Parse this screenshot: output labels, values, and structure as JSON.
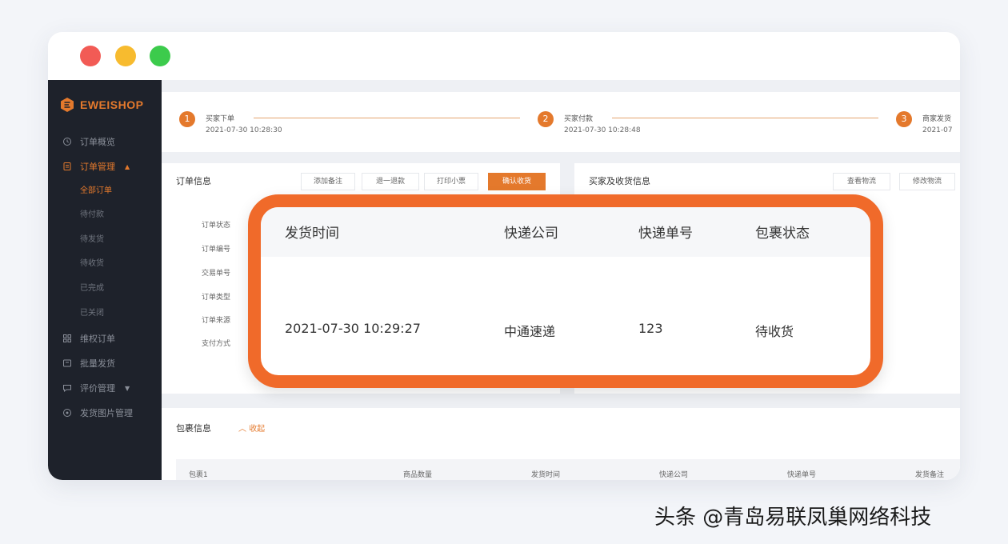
{
  "window": {
    "controls": [
      {
        "name": "close",
        "color": "#f25b55"
      },
      {
        "name": "minimize",
        "color": "#f7bb2f"
      },
      {
        "name": "maximize",
        "color": "#3ccb4c"
      }
    ]
  },
  "brand": {
    "name": "EWEISHOP",
    "accent": "#e4792c",
    "callout_color": "#f06a2a"
  },
  "sidebar": {
    "items": [
      {
        "label": "订单概览",
        "icon": "clock-icon"
      },
      {
        "label": "订单管理",
        "icon": "document-icon",
        "active": true,
        "expanded": true
      },
      {
        "label": "维权订单",
        "icon": "grid-icon"
      },
      {
        "label": "批量发货",
        "icon": "box-icon"
      },
      {
        "label": "评价管理",
        "icon": "chat-icon",
        "has_caret": true
      },
      {
        "label": "发货图片管理",
        "icon": "image-icon"
      }
    ],
    "sub_items": [
      "全部订单",
      "待付款",
      "待发货",
      "待收货",
      "已完成",
      "已关闭"
    ],
    "active_sub_item": "全部订单"
  },
  "progress": {
    "steps": [
      {
        "number": "1",
        "title": "买家下单",
        "time": "2021-07-30 10:28:30"
      },
      {
        "number": "2",
        "title": "买家付款",
        "time": "2021-07-30 10:28:48"
      },
      {
        "number": "3",
        "title": "商家发货",
        "time": "2021-07"
      }
    ]
  },
  "order_info": {
    "title": "订单信息",
    "buttons": [
      "添加备注",
      "退一退款",
      "打印小票",
      "确认收货"
    ],
    "primary_button": "确认收货",
    "fields": [
      "订单状态",
      "订单编号",
      "交易单号",
      "订单类型",
      "订单来源",
      "支付方式"
    ]
  },
  "buyer_info": {
    "title": "买家及收货信息",
    "buttons": [
      "查看物流",
      "修改物流"
    ]
  },
  "package_info": {
    "title": "包裹信息",
    "collapse_label": "收起",
    "columns": [
      "包裹1",
      "商品数量",
      "发货时间",
      "快递公司",
      "快递单号",
      "发货备注"
    ]
  },
  "callout": {
    "columns": [
      "发货时间",
      "快递公司",
      "快递单号",
      "包裹状态"
    ],
    "row": {
      "ship_time": "2021-07-30 10:29:27",
      "carrier": "中通速递",
      "tracking_no": "123",
      "status": "待收货"
    }
  },
  "watermark": "头条 @青岛易联凤巢网络科技"
}
